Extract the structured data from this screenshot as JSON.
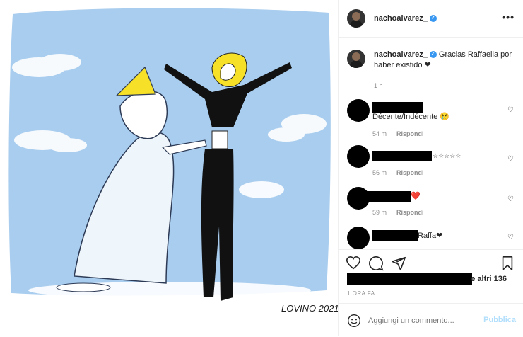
{
  "post": {
    "username": "nachoalvarez_",
    "caption": "Gracias Raffaella por haber existido ❤",
    "caption_time": "1 h"
  },
  "illustration": {
    "signature": "LOVINO 2021"
  },
  "comments": [
    {
      "text": "Décente/Indécente 😢",
      "time": "54 m",
      "reply": "Rispondi"
    },
    {
      "text": "☆☆☆☆☆",
      "time": "56 m",
      "reply": "Rispondi"
    },
    {
      "text": "❤️",
      "time": "59 m",
      "reply": "Rispondi"
    },
    {
      "text": "Raffa❤",
      "time": "",
      "reply": ""
    }
  ],
  "likes": {
    "suffix": "e altri 136"
  },
  "post_time": "1 ORA FA",
  "add_comment": {
    "placeholder": "Aggiungi un commento...",
    "publish": "Pubblica"
  },
  "colors": {
    "accent": "#3897f0",
    "sky": "#a9cdee",
    "heart": "#d83a4e"
  },
  "icons": [
    "more-icon",
    "heart-icon",
    "comment-icon",
    "share-icon",
    "bookmark-icon",
    "emoji-icon",
    "verified-icon"
  ]
}
